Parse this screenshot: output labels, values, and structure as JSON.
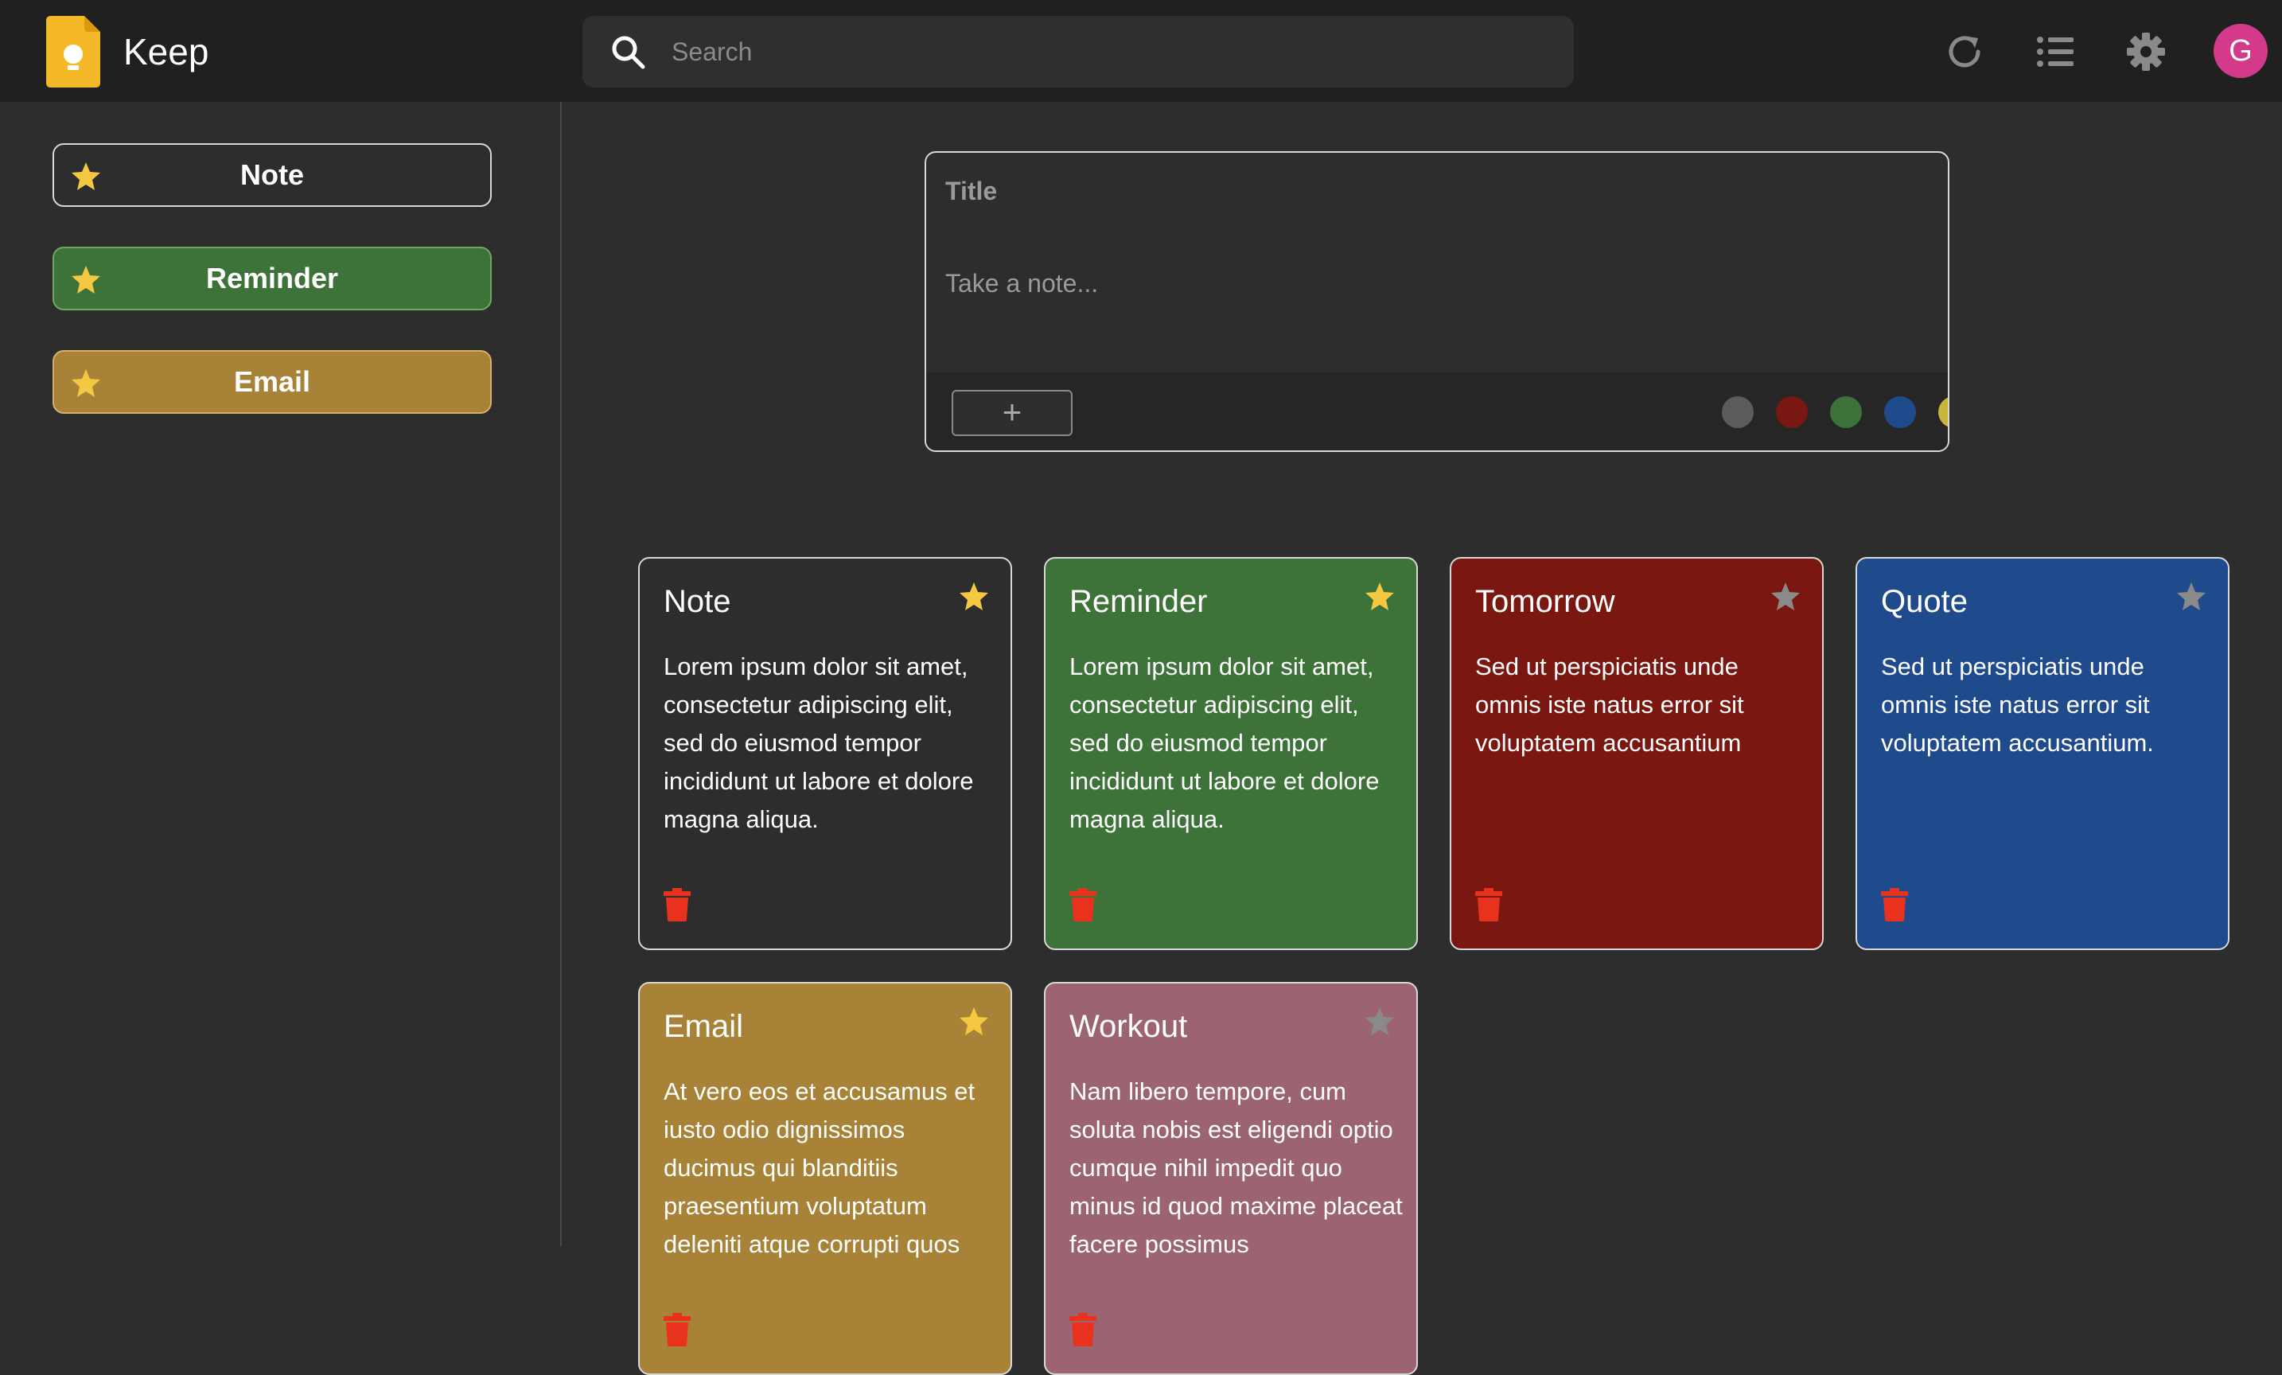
{
  "app": {
    "title": "Keep",
    "user_initial": "G"
  },
  "search": {
    "placeholder": "Search"
  },
  "header": {
    "icons": [
      "refresh-icon",
      "list-view-icon",
      "settings-icon"
    ]
  },
  "sidebar": {
    "items": [
      {
        "label": "Note",
        "color": "#2d2d2d"
      },
      {
        "label": "Reminder",
        "color": "#3d7238"
      },
      {
        "label": "Email",
        "color": "#a88337"
      }
    ]
  },
  "composer": {
    "title_placeholder": "Title",
    "body_placeholder": "Take a note...",
    "add_label": "+",
    "colors": [
      "#5c5c5c",
      "#7a1712",
      "#3d7238",
      "#1f4b8c",
      "#c9b53a",
      "#a88337",
      "#a0646e"
    ]
  },
  "notes": [
    {
      "title": "Note",
      "body": "Lorem ipsum dolor sit amet, consectetur adipiscing elit, sed do eiusmod tempor incididunt ut labore et dolore magna aliqua.",
      "color": "#2d2d2d",
      "starred": true
    },
    {
      "title": "Reminder",
      "body": "Lorem ipsum dolor sit amet, consectetur adipiscing elit, sed do eiusmod tempor incididunt ut labore et dolore magna aliqua.",
      "color": "#3d7238",
      "starred": true
    },
    {
      "title": "Tomorrow",
      "body": "Sed ut perspiciatis unde omnis iste natus error sit voluptatem accusantium",
      "color": "#7a1710",
      "starred": false
    },
    {
      "title": "Quote",
      "body": "Sed ut perspiciatis unde omnis iste natus error sit voluptatem accusantium.",
      "color": "#1f4b8c",
      "starred": false
    },
    {
      "title": "Email",
      "body": "At vero eos et accusamus et iusto odio dignissimos ducimus qui blanditiis praesentium voluptatum deleniti atque corrupti quos",
      "color": "#a88337",
      "starred": true
    },
    {
      "title": "Workout",
      "body": "Nam libero tempore, cum soluta nobis est eligendi optio cumque nihil impedit quo minus id quod maxime placeat facere possimus",
      "color": "#9c6470",
      "starred": false
    }
  ],
  "colors": {
    "star_active": "#f5c842",
    "star_inactive": "#8a8a8a",
    "trash": "#e8321e"
  }
}
